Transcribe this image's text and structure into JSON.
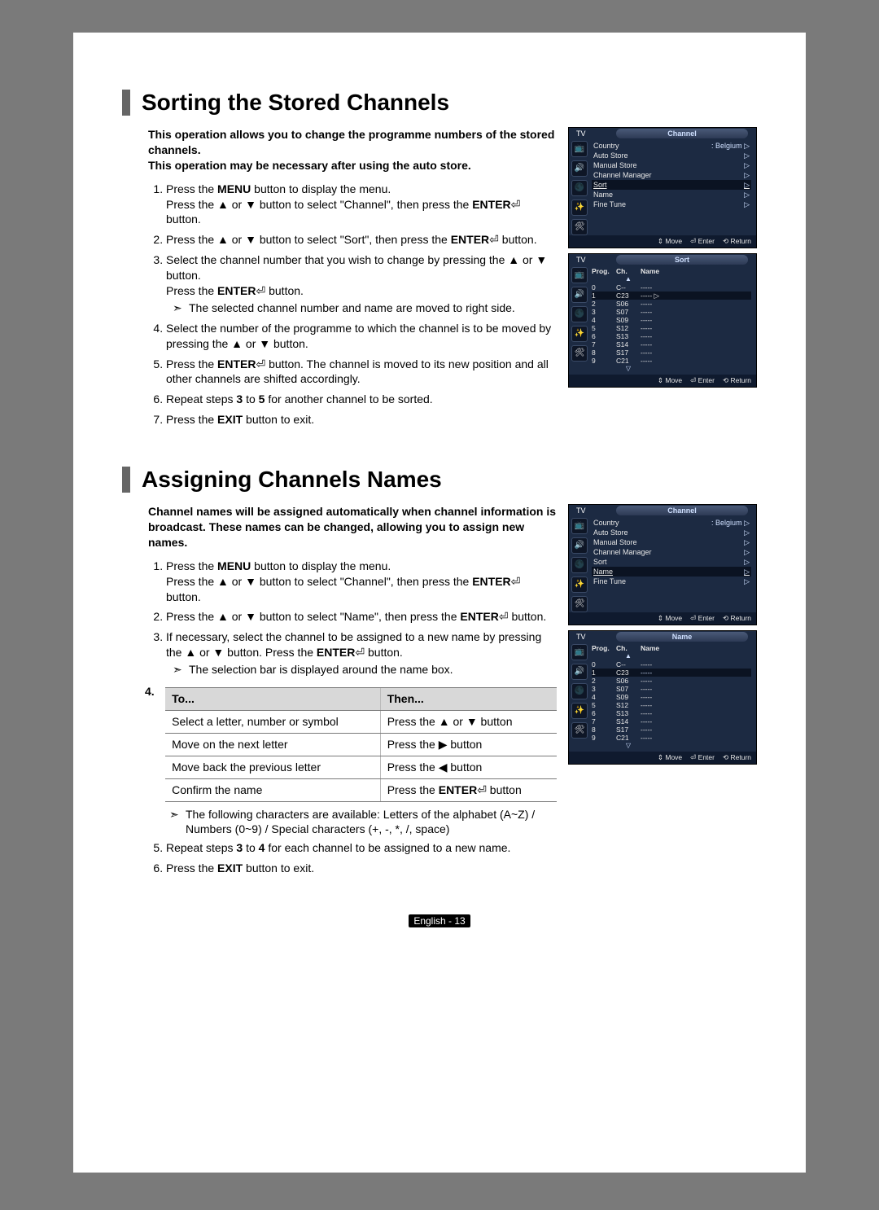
{
  "section1": {
    "title": "Sorting the Stored Channels",
    "intro1": "This operation allows you to change the programme numbers of the stored channels.",
    "intro2": "This operation may be necessary after using the auto store.",
    "step1_a": "Press the ",
    "step1_menu": "MENU",
    "step1_b": " button to display the menu.",
    "step1_c": "Press the ▲ or ▼ button to select \"Channel\", then press the ",
    "step1_enter": "ENTER",
    "step1_d": " button.",
    "step2_a": "Press the ▲ or ▼ button to select \"Sort\", then press the ",
    "step2_enter": "ENTER",
    "step2_b": " button.",
    "step3_a": "Select the channel number that you wish to change by pressing the ▲ or ▼ button.",
    "step3_b": "Press the ",
    "step3_enter": "ENTER",
    "step3_c": " button.",
    "step3_sub": "The selected channel number and name are moved to right side.",
    "step4": "Select the number of the programme to which the channel is to be moved by pressing the ▲ or ▼ button.",
    "step5_a": "Press the ",
    "step5_enter": "ENTER",
    "step5_b": " button. The channel is moved to its new position and all other channels are shifted accordingly.",
    "step6_a": "Repeat steps ",
    "step6_b": "3",
    "step6_c": " to ",
    "step6_d": "5",
    "step6_e": " for another channel to be sorted.",
    "step7_a": "Press the ",
    "step7_exit": "EXIT",
    "step7_b": " button to exit."
  },
  "section2": {
    "title": "Assigning Channels Names",
    "intro": "Channel names will be assigned automatically when channel information is broadcast. These names can be changed, allowing you to assign new names.",
    "step1_a": "Press the ",
    "step1_menu": "MENU",
    "step1_b": " button to display the menu.",
    "step1_c": "Press the ▲ or ▼ button to select \"Channel\", then press the ",
    "step1_enter": "ENTER",
    "step1_d": " button.",
    "step2_a": "Press the ▲ or ▼ button to select \"Name\", then press the ",
    "step2_enter": "ENTER",
    "step2_b": " button.",
    "step3_a": "If necessary, select the channel to be assigned to a new name by pressing the ▲ or ▼ button. Press the ",
    "step3_enter": "ENTER",
    "step3_b": " button.",
    "step3_sub": "The selection bar is displayed around the name box.",
    "step4_num": "4.",
    "t_to": "To...",
    "t_then": "Then...",
    "r1a": "Select a letter, number or symbol",
    "r1b": "Press the ▲ or ▼ button",
    "r2a": "Move on the next letter",
    "r2b": "Press the ▶ button",
    "r3a": "Move back the previous letter",
    "r3b": "Press the ◀ button",
    "r4a": "Confirm the name",
    "r4b_a": "Press the ",
    "r4b_enter": "ENTER",
    "r4b_b": " button",
    "post_sub": "The following characters are available: Letters of the alphabet (A~Z) / Numbers (0~9) / Special characters (+, -, *, /, space)",
    "step5_a": "Repeat steps ",
    "step5_b": "3",
    "step5_c": " to ",
    "step5_d": "4",
    "step5_e": " for each channel to be assigned to a new name.",
    "step6_a": "Press the ",
    "step6_exit": "EXIT",
    "step6_b": " button to exit."
  },
  "osd": {
    "tv": "TV",
    "channel_title": "Channel",
    "sort_title": "Sort",
    "name_title": "Name",
    "move": "Move",
    "enter": "Enter",
    "return": "Return",
    "icons": [
      "📺",
      "🔊",
      "🌑",
      "✨",
      "🛠"
    ],
    "channel_menu": {
      "items": [
        {
          "label": "Country",
          "value": ": Belgium"
        },
        {
          "label": "Auto Store",
          "value": ""
        },
        {
          "label": "Manual Store",
          "value": ""
        },
        {
          "label": "Channel Manager",
          "value": ""
        },
        {
          "label": "Sort",
          "value": ""
        },
        {
          "label": "Name",
          "value": ""
        },
        {
          "label": "Fine Tune",
          "value": ""
        }
      ],
      "hl_index_a": 4,
      "hl_index_b": 5
    },
    "sort_table": {
      "headers": [
        "Prog.",
        "Ch.",
        "Name"
      ],
      "rows": [
        {
          "prog": "0",
          "ch": "C--",
          "name": "-----"
        },
        {
          "prog": "1",
          "ch": "C23",
          "name": "-----"
        },
        {
          "prog": "2",
          "ch": "S06",
          "name": "-----"
        },
        {
          "prog": "3",
          "ch": "S07",
          "name": "-----"
        },
        {
          "prog": "4",
          "ch": "S09",
          "name": "-----"
        },
        {
          "prog": "5",
          "ch": "S12",
          "name": "-----"
        },
        {
          "prog": "6",
          "ch": "S13",
          "name": "-----"
        },
        {
          "prog": "7",
          "ch": "S14",
          "name": "-----"
        },
        {
          "prog": "8",
          "ch": "S17",
          "name": "-----"
        },
        {
          "prog": "9",
          "ch": "C21",
          "name": "-----"
        }
      ],
      "hl_index": 1
    },
    "name_table": {
      "headers": [
        "Prog.",
        "Ch.",
        "Name"
      ],
      "rows": [
        {
          "prog": "0",
          "ch": "C--",
          "name": "-----"
        },
        {
          "prog": "1",
          "ch": "C23",
          "name": "-----"
        },
        {
          "prog": "2",
          "ch": "S06",
          "name": "-----"
        },
        {
          "prog": "3",
          "ch": "S07",
          "name": "-----"
        },
        {
          "prog": "4",
          "ch": "S09",
          "name": "-----"
        },
        {
          "prog": "5",
          "ch": "S12",
          "name": "-----"
        },
        {
          "prog": "6",
          "ch": "S13",
          "name": "-----"
        },
        {
          "prog": "7",
          "ch": "S14",
          "name": "-----"
        },
        {
          "prog": "8",
          "ch": "S17",
          "name": "-----"
        },
        {
          "prog": "9",
          "ch": "C21",
          "name": "-----"
        }
      ],
      "hl_index": 1
    }
  },
  "glyphs": {
    "enter_icon": "⏎",
    "updown": "⇕",
    "enter_foot": "⏎",
    "return": "⟲",
    "up": "▲",
    "down": "▽",
    "right_trail": "▷"
  },
  "footer": "English - 13"
}
